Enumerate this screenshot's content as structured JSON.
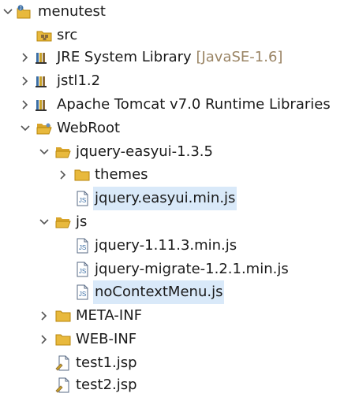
{
  "tree": {
    "project": {
      "label": "menutest",
      "expanded": true
    },
    "src": {
      "label": "src"
    },
    "jre": {
      "label": "JRE System Library",
      "decoration": "[JavaSE-1.6]"
    },
    "jstl": {
      "label": "jstl1.2"
    },
    "tomcat": {
      "label": "Apache Tomcat v7.0 Runtime Libraries"
    },
    "webroot": {
      "label": "WebRoot",
      "expanded": true
    },
    "easyui": {
      "label": "jquery-easyui-1.3.5",
      "expanded": true
    },
    "themes": {
      "label": "themes"
    },
    "easyui_min": {
      "label": "jquery.easyui.min.js",
      "selected": true
    },
    "js": {
      "label": "js",
      "expanded": true
    },
    "jquery": {
      "label": "jquery-1.11.3.min.js"
    },
    "migrate": {
      "label": "jquery-migrate-1.2.1.min.js"
    },
    "nocontext": {
      "label": "noContextMenu.js",
      "selected": true
    },
    "metainf": {
      "label": "META-INF"
    },
    "webinf": {
      "label": "WEB-INF"
    },
    "test1": {
      "label": "test1.jsp"
    },
    "test2": {
      "label": "test2.jsp"
    }
  },
  "colors": {
    "folder": "#e8b93d",
    "jar": "#8a6a3a",
    "selection": "#d9e9f9",
    "decoration": "#9a8464",
    "twisty": "#555555"
  },
  "icons": {
    "project": "java-project-icon",
    "source_folder": "package-folder-icon",
    "library": "library-icon",
    "folder": "folder-icon",
    "js_file": "js-file-icon",
    "jsp_file": "jsp-file-icon"
  }
}
